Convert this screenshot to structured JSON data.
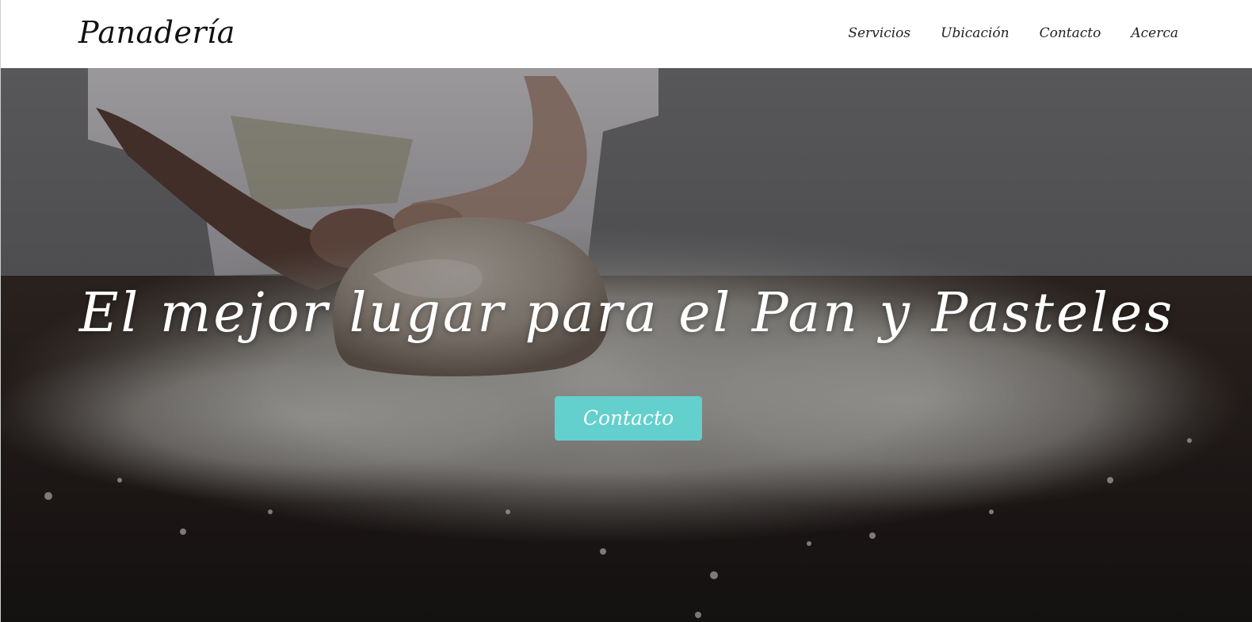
{
  "header": {
    "logo_text": "Panadería",
    "nav": {
      "items": [
        {
          "label": "Servicios"
        },
        {
          "label": "Ubicación"
        },
        {
          "label": "Contacto"
        },
        {
          "label": "Acerca"
        }
      ]
    }
  },
  "hero": {
    "title": "El mejor lugar para el Pan y Pasteles",
    "button_label": "Contacto",
    "image_semantic": "baker-kneading-bread-dough-on-floured-table",
    "colors": {
      "button": "#63d0cd",
      "title_text": "#ffffff"
    }
  }
}
